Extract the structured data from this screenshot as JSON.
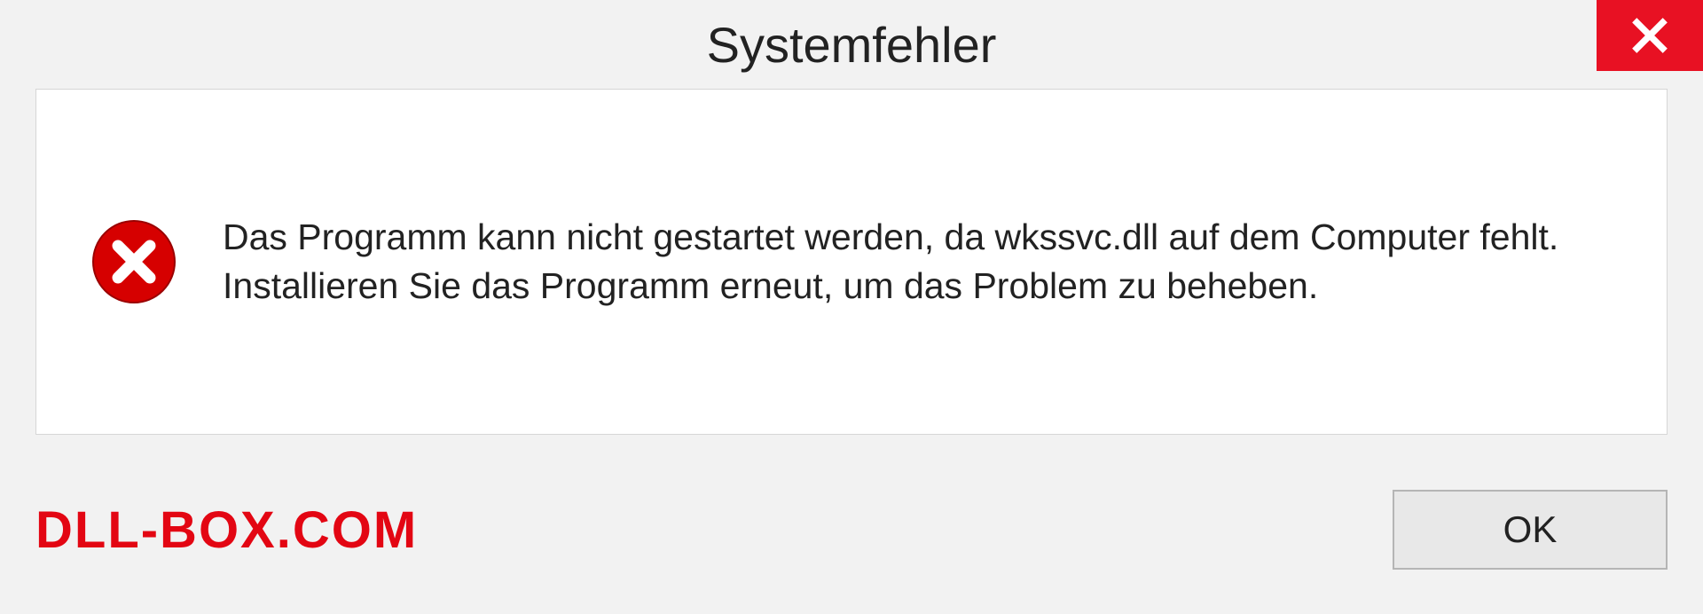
{
  "dialog": {
    "title": "Systemfehler",
    "message": "Das Programm kann nicht gestartet werden, da wkssvc.dll auf dem Computer fehlt. Installieren Sie das Programm erneut, um das Problem zu beheben.",
    "ok_label": "OK"
  },
  "watermark": "DLL-BOX.COM",
  "colors": {
    "close_bg": "#e81123",
    "error_red": "#d60000",
    "brand_red": "#e30613"
  }
}
